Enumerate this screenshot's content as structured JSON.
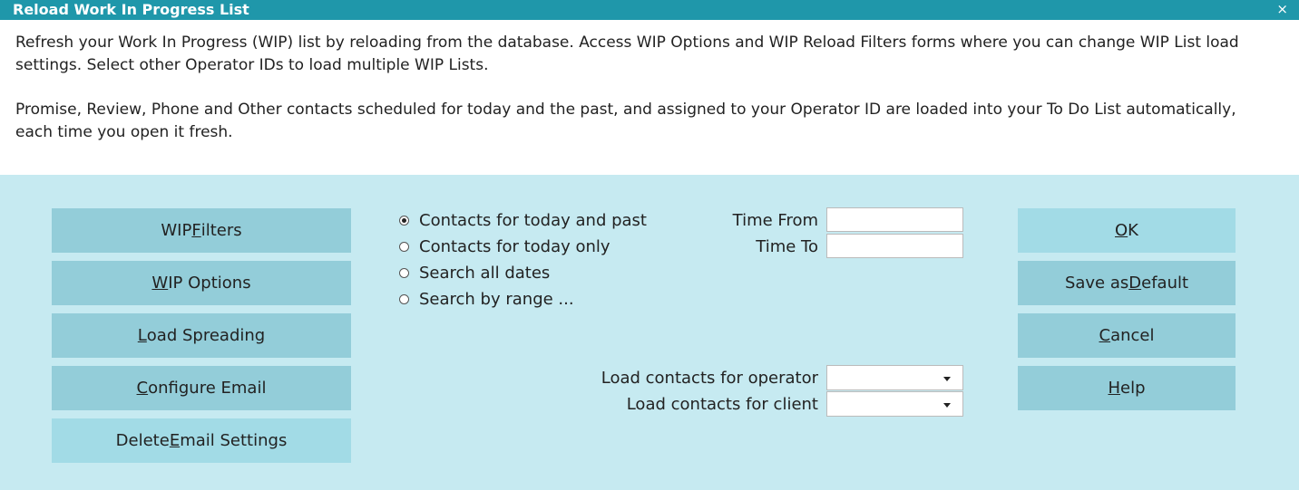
{
  "window": {
    "title": "Reload Work In Progress List",
    "close_glyph": "×"
  },
  "description": {
    "para1": "Refresh your Work In Progress (WIP) list by reloading from the database. Access WIP Options and WIP Reload Filters forms where you can change WIP List load settings. Select other Operator IDs to load multiple WIP Lists.",
    "para2": "Promise, Review, Phone and Other contacts scheduled for today and the past, and assigned to your Operator ID are loaded into your To Do List automatically, each time you open it fresh."
  },
  "left_buttons": [
    {
      "pre": "WIP ",
      "mnemonic": "F",
      "post": "ilters"
    },
    {
      "pre": "",
      "mnemonic": "W",
      "post": "IP Options"
    },
    {
      "pre": "",
      "mnemonic": "L",
      "post": "oad Spreading"
    },
    {
      "pre": "",
      "mnemonic": "C",
      "post": "onfigure Email"
    },
    {
      "pre": "Delete ",
      "mnemonic": "E",
      "post": "mail Settings"
    }
  ],
  "contact_options": [
    {
      "label": "Contacts for today and past",
      "selected": true
    },
    {
      "label": "Contacts for today only",
      "selected": false
    },
    {
      "label": "Search all dates",
      "selected": false
    },
    {
      "label": "Search by range ...",
      "selected": false
    }
  ],
  "time": {
    "from_label": "Time From",
    "from_value": "",
    "to_label": "Time To",
    "to_value": ""
  },
  "load": {
    "operator_label": "Load contacts for operator",
    "operator_value": "",
    "client_label": "Load contacts for client",
    "client_value": ""
  },
  "right_buttons": [
    {
      "pre": "",
      "mnemonic": "O",
      "post": "K"
    },
    {
      "pre": "Save as ",
      "mnemonic": "D",
      "post": "efault"
    },
    {
      "pre": "",
      "mnemonic": "C",
      "post": "ancel"
    },
    {
      "pre": "",
      "mnemonic": "H",
      "post": "elp"
    }
  ],
  "colors": {
    "titlebar": "#1f97aa",
    "panel": "#c6eaf1",
    "button": "#93cdd9",
    "button_alt": "#a2dbe6"
  }
}
